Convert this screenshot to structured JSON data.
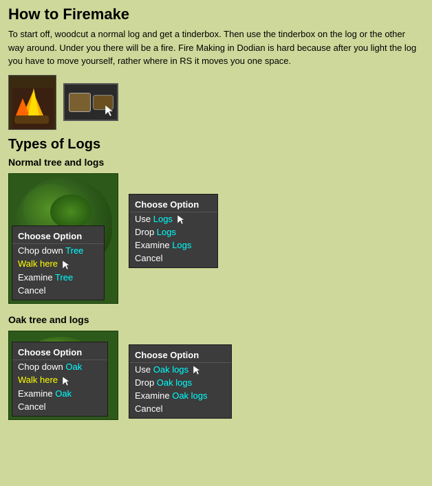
{
  "page": {
    "title": "How to Firemake",
    "intro": "To start off, woodcut a normal log and get a tinderbox.  Then use the tinderbox on the log or the other way around.  Under you there will be a fire.  Fire Making in Dodian is hard because after you light the log you have to move yourself, rather where in RS it  moves you one space."
  },
  "types_section": {
    "title": "Types of Logs",
    "normal_label": "Normal tree and logs",
    "oak_label": "Oak tree and logs"
  },
  "tree_context_menu": {
    "title": "Choose Option",
    "items": [
      {
        "label": "Chop down",
        "highlight": "Tree",
        "color": "white",
        "highlight_color": "cyan"
      },
      {
        "label": "Walk here",
        "color": "yellow"
      },
      {
        "label": "Examine",
        "highlight": "Tree",
        "color": "white",
        "highlight_color": "cyan"
      },
      {
        "label": "Cancel",
        "color": "white"
      }
    ]
  },
  "logs_context_menu": {
    "title": "Choose Option",
    "items": [
      {
        "label": "Use ",
        "highlight": "Logs",
        "color": "white",
        "highlight_color": "cyan"
      },
      {
        "label": "Drop ",
        "highlight": "Logs",
        "color": "white",
        "highlight_color": "cyan"
      },
      {
        "label": "Examine ",
        "highlight": "Logs",
        "color": "white",
        "highlight_color": "cyan"
      },
      {
        "label": "Cancel",
        "color": "white"
      }
    ]
  },
  "oak_tree_context_menu": {
    "title": "Choose Option",
    "items": [
      {
        "label": "Chop down ",
        "highlight": "Oak",
        "color": "white",
        "highlight_color": "cyan"
      },
      {
        "label": "Walk here",
        "color": "yellow"
      },
      {
        "label": "Examine ",
        "highlight": "Oak",
        "color": "white",
        "highlight_color": "cyan"
      },
      {
        "label": "Cancel",
        "color": "white"
      }
    ]
  },
  "oak_logs_context_menu": {
    "title": "Choose Option",
    "items": [
      {
        "label": "Use ",
        "highlight": "Oak logs",
        "color": "white",
        "highlight_color": "cyan"
      },
      {
        "label": "Drop ",
        "highlight": "Oak logs",
        "color": "white",
        "highlight_color": "cyan"
      },
      {
        "label": "Examine ",
        "highlight": "Oak logs",
        "color": "white",
        "highlight_color": "cyan"
      },
      {
        "label": "Cancel",
        "color": "white"
      }
    ]
  }
}
